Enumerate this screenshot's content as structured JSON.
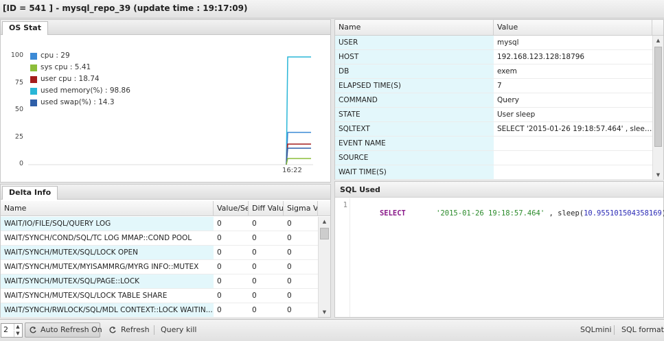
{
  "title": "[ID = 541 ] - mysql_repo_39 (update time : 19:17:09)",
  "os_stat": {
    "tab_label": "OS Stat",
    "y_ticks": [
      "100",
      "75",
      "50",
      "25",
      "0"
    ],
    "x_label": "16:22",
    "legend": [
      {
        "label": "cpu : 29",
        "color": "#3c8ad6"
      },
      {
        "label": "sys cpu : 5.41",
        "color": "#8cbd3a"
      },
      {
        "label": "user cpu : 18.74",
        "color": "#a41c1c"
      },
      {
        "label": "used memory(%) : 98.86",
        "color": "#29b6d7"
      },
      {
        "label": "used swap(%) : 14.3",
        "color": "#2f5fa8"
      }
    ]
  },
  "delta": {
    "tab_label": "Delta Info",
    "columns": [
      "Name",
      "Value/Se",
      "Diff Valu",
      "Sigma Va"
    ],
    "rows": [
      [
        "WAIT/IO/FILE/SQL/QUERY LOG",
        "0",
        "0",
        "0"
      ],
      [
        "WAIT/SYNCH/COND/SQL/TC LOG MMAP::COND POOL",
        "0",
        "0",
        "0"
      ],
      [
        "WAIT/SYNCH/MUTEX/SQL/LOCK OPEN",
        "0",
        "0",
        "0"
      ],
      [
        "WAIT/SYNCH/MUTEX/MYISAMMRG/MYRG INFO::MUTEX",
        "0",
        "0",
        "0"
      ],
      [
        "WAIT/SYNCH/MUTEX/SQL/PAGE::LOCK",
        "0",
        "0",
        "0"
      ],
      [
        "WAIT/SYNCH/MUTEX/SQL/LOCK TABLE SHARE",
        "0",
        "0",
        "0"
      ],
      [
        "WAIT/SYNCH/RWLOCK/SQL/MDL CONTEXT::LOCK WAITIN...",
        "0",
        "0",
        "0"
      ]
    ]
  },
  "props": {
    "columns": [
      "Name",
      "Value"
    ],
    "rows": [
      [
        "USER",
        "mysql"
      ],
      [
        "HOST",
        "192.168.123.128:18796"
      ],
      [
        "DB",
        "exem"
      ],
      [
        "ELAPSED TIME(S)",
        "7"
      ],
      [
        "COMMAND",
        "Query"
      ],
      [
        "STATE",
        "User sleep"
      ],
      [
        "SQLTEXT",
        "SELECT '2015-01-26 19:18:57.464' , sleep(..."
      ],
      [
        "EVENT NAME",
        ""
      ],
      [
        "SOURCE",
        ""
      ],
      [
        "WAIT TIME(S)",
        ""
      ]
    ]
  },
  "sql_used": {
    "title": "SQL Used",
    "line_number": "1",
    "keyword": "SELECT",
    "string_literal": "'2015-01-26 19:18:57.464'",
    "rest_prefix": " , sleep(",
    "number": "10.955101504358169",
    "rest_suffix": ")"
  },
  "toolbar": {
    "spinner_value": "2",
    "auto_refresh_label": "Auto Refresh On",
    "refresh_label": "Refresh",
    "query_kill_label": "Query kill",
    "sqlmini_label": "SQLmini",
    "sql_format_label": "SQL format"
  }
}
